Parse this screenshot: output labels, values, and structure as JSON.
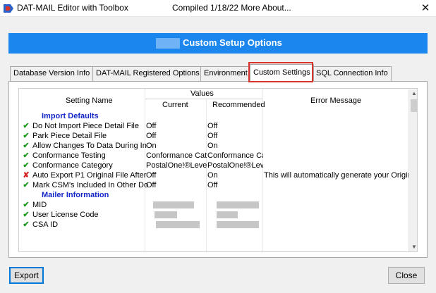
{
  "window": {
    "title": "DAT-MAIL Editor with Toolbox",
    "compiled": "Compiled 1/18/22 More About...",
    "close_glyph": "✕"
  },
  "banner": {
    "title": "Custom Setup Options"
  },
  "tabs": [
    {
      "label": "Database Version Info"
    },
    {
      "label": "DAT-MAIL Registered Options"
    },
    {
      "label": "Environment"
    },
    {
      "label": "Custom Settings",
      "active": true
    },
    {
      "label": "SQL Connection Info"
    }
  ],
  "grid": {
    "headers": {
      "setting_name": "Setting Name",
      "values": "Values",
      "current": "Current",
      "recommended": "Recommended",
      "error_message": "Error Message"
    },
    "sections": [
      {
        "title": "Import Defaults"
      },
      {
        "title": "Mailer Information"
      }
    ],
    "rows": [
      {
        "status": "ok",
        "name": "Do Not Import Piece Detail File",
        "current": "Off",
        "recommended": "Off",
        "message": ""
      },
      {
        "status": "ok",
        "name": "Park Piece Detail File",
        "current": "Off",
        "recommended": "Off",
        "message": ""
      },
      {
        "status": "ok",
        "name": "Allow Changes To Data During In",
        "current": "On",
        "recommended": "On",
        "message": ""
      },
      {
        "status": "ok",
        "name": "Conformance Testing",
        "current": "Conformance Cat",
        "recommended": "Conformance Ca",
        "message": ""
      },
      {
        "status": "ok",
        "name": "Conformance Category",
        "current": "PostalOne!®Level",
        "recommended": "PostalOne!®Lev",
        "message": ""
      },
      {
        "status": "error",
        "name": "Auto Export P1 Original File After",
        "current": "Off",
        "recommended": "On",
        "message": "This will automatically generate your Origin"
      },
      {
        "status": "ok",
        "name": "Mark CSM's Included In Other Do",
        "current": "Off",
        "recommended": "Off",
        "message": ""
      },
      {
        "status": "ok",
        "name": "MID",
        "current": "",
        "recommended": "",
        "message": ""
      },
      {
        "status": "ok",
        "name": "User License Code",
        "current": "",
        "recommended": "",
        "message": ""
      },
      {
        "status": "ok",
        "name": "CSA ID",
        "current": "",
        "recommended": "",
        "message": ""
      }
    ],
    "status_glyphs": {
      "ok": "✔",
      "error": "✘"
    },
    "status_colors": {
      "ok": "#1f9a1f",
      "error": "#d62020"
    }
  },
  "buttons": {
    "export": "Export",
    "close": "Close"
  },
  "colors": {
    "banner": "#1a86ee",
    "highlight": "#d9342b",
    "section_title": "#1427c8"
  }
}
